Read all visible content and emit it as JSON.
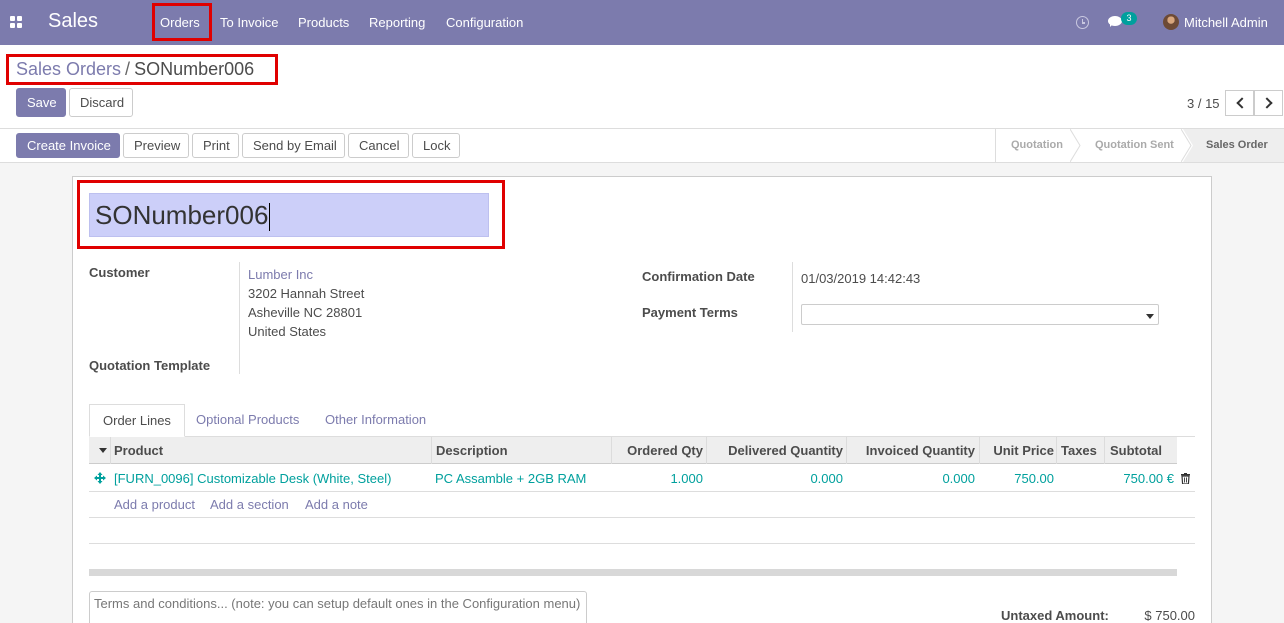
{
  "navbar": {
    "app_name": "Sales",
    "menu": [
      "Orders",
      "To Invoice",
      "Products",
      "Reporting",
      "Configuration"
    ],
    "chat_count": "3",
    "user_name": "Mitchell Admin",
    "icons": [
      "apps-icon",
      "clock-icon",
      "chat-icon"
    ]
  },
  "breadcrumb": {
    "parent": "Sales Orders",
    "separator": "/",
    "current": "SONumber006"
  },
  "form_buttons": {
    "save": "Save",
    "discard": "Discard"
  },
  "pager": {
    "value": "3 / 15"
  },
  "actions": [
    "Create Invoice",
    "Preview",
    "Print",
    "Send by Email",
    "Cancel",
    "Lock"
  ],
  "statusbar": {
    "stages": [
      "Quotation",
      "Quotation Sent",
      "Sales Order"
    ],
    "active": "Sales Order"
  },
  "form": {
    "name": "SONumber006",
    "customer_label": "Customer",
    "customer_name": "Lumber Inc",
    "address_line1": "3202 Hannah Street",
    "address_line2": "Asheville NC 28801",
    "address_line3": "United States",
    "quotation_template_label": "Quotation Template",
    "confirmation_date_label": "Confirmation Date",
    "confirmation_date": "01/03/2019 14:42:43",
    "payment_terms_label": "Payment Terms",
    "payment_terms": ""
  },
  "tabs": [
    "Order Lines",
    "Optional Products",
    "Other Information"
  ],
  "order_lines": {
    "columns": [
      "Product",
      "Description",
      "Ordered Qty",
      "Delivered Quantity",
      "Invoiced Quantity",
      "Unit Price",
      "Taxes",
      "Subtotal"
    ],
    "rows": [
      {
        "product": "[FURN_0096] Customizable Desk (White, Steel)",
        "description": "PC Assamble + 2GB RAM",
        "ordered_qty": "1.000",
        "delivered_qty": "0.000",
        "invoiced_qty": "0.000",
        "unit_price": "750.00",
        "taxes": "",
        "subtotal": "750.00 €"
      }
    ],
    "add_links": [
      "Add a product",
      "Add a section",
      "Add a note"
    ]
  },
  "terms_placeholder": "Terms and conditions... (note: you can setup default ones in the Configuration menu)",
  "totals": {
    "untaxed_label": "Untaxed Amount:",
    "untaxed_value": "$ 750.00"
  },
  "colors": {
    "brand": "#7c7bad",
    "link_teal": "#00a09d",
    "highlight": "#e00000",
    "name_field_bg": "#cccff9"
  }
}
